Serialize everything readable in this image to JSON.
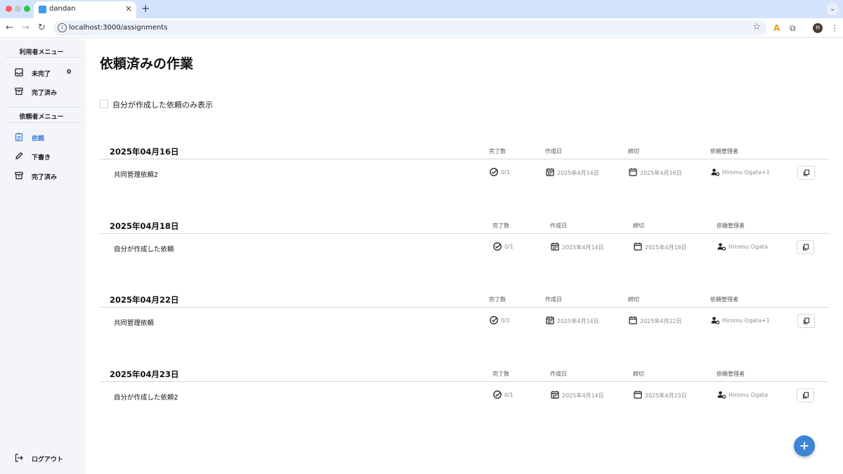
{
  "browser": {
    "tab_title": "dandan",
    "url": "localhost:3000/assignments",
    "profile_initial": "H",
    "traffic_colors": [
      "#ff5f57",
      "#c7c7c7",
      "#28c840"
    ]
  },
  "sidebar": {
    "user_menu_title": "利用者メニュー",
    "user_items": [
      {
        "label": "未完了",
        "count": "0",
        "icon": "inbox-icon"
      },
      {
        "label": "完了済み",
        "icon": "archive-icon"
      }
    ],
    "requester_menu_title": "依頼者メニュー",
    "requester_items": [
      {
        "label": "依頼",
        "icon": "clipboard-icon",
        "active": true
      },
      {
        "label": "下書き",
        "icon": "pencil-icon"
      },
      {
        "label": "完了済み",
        "icon": "archive-icon"
      }
    ],
    "logout_label": "ログアウト"
  },
  "main": {
    "title": "依頼済みの作業",
    "filter_label": "自分が作成した依頼のみ表示",
    "columns": {
      "done": "完了数",
      "created": "作成日",
      "deadline": "締切",
      "manager": "依頼管理者"
    },
    "groups": [
      {
        "date": "2025年04月16日",
        "name": "共同管理依頼2",
        "done": "0/1",
        "created": "2025年4月14日",
        "deadline": "2025年4月16日",
        "manager": "Hiromu Ogata+1"
      },
      {
        "date": "2025年04月18日",
        "name": "自分が作成した依頼",
        "done": "0/1",
        "created": "2025年4月14日",
        "deadline": "2025年4月18日",
        "manager": "Hiromu Ogata"
      },
      {
        "date": "2025年04月22日",
        "name": "共同管理依頼",
        "done": "0/1",
        "created": "2025年4月14日",
        "deadline": "2025年4月22日",
        "manager": "Hiromu Ogata+1"
      },
      {
        "date": "2025年04月23日",
        "name": "自分が作成した依頼2",
        "done": "0/1",
        "created": "2025年4月14日",
        "deadline": "2025年4月23日",
        "manager": "Hiromu Ogata"
      }
    ]
  },
  "colors": {
    "accent": "#3a7bd5",
    "fab": "#3d86d6",
    "sidebar_bg": "#f3f5fb"
  }
}
